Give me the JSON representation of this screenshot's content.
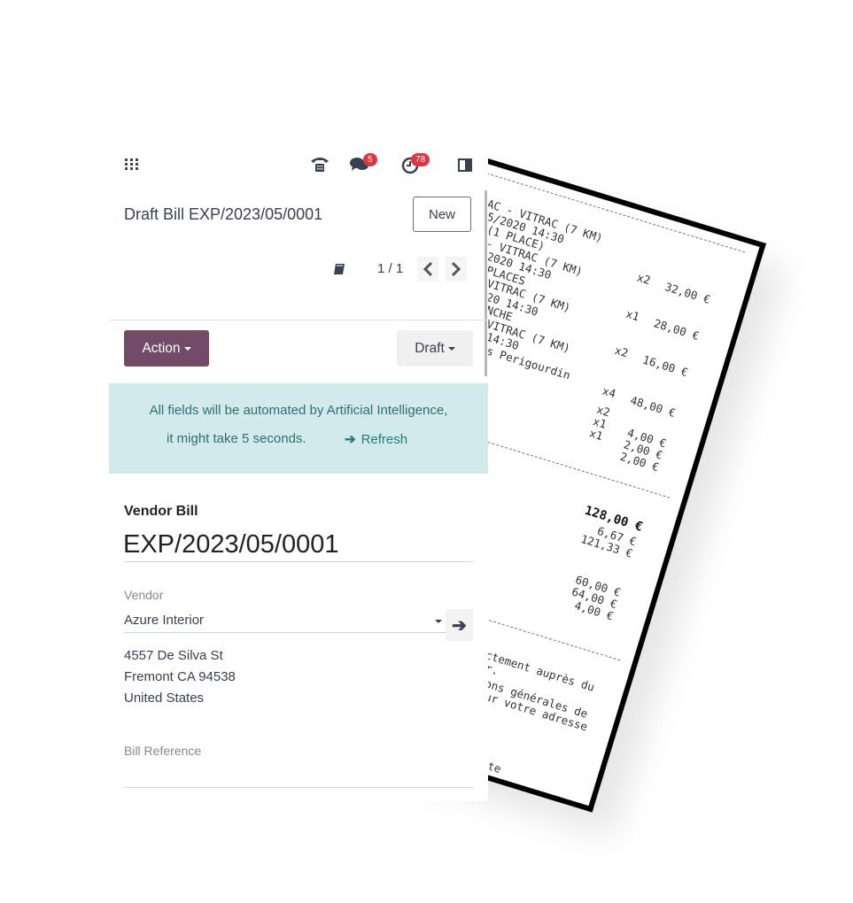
{
  "topbar": {
    "apps_icon": "grid-icon",
    "phone_icon": "phone-icon",
    "messages_icon": "chat-icon",
    "messages_count": "5",
    "activities_icon": "clock-icon",
    "activities_count": "78",
    "panel_icon": "split-panel-icon"
  },
  "header": {
    "title": "Draft Bill EXP/2023/05/0001",
    "new_label": "New",
    "pager": "1 / 1"
  },
  "actions": {
    "action_label": "Action",
    "status_label": "Draft"
  },
  "banner": {
    "line1": "All fields will be automated by Artificial Intelligence,",
    "line2": "it might take 5 seconds.",
    "refresh_label": "Refresh"
  },
  "form": {
    "heading": "Vendor Bill",
    "number": "EXP/2023/05/0001",
    "vendor_label": "Vendor",
    "vendor_value": "Azure Interior",
    "address": [
      "4557 De Silva St",
      "Fremont CA 94538",
      "United States"
    ],
    "bill_reference_label": "Bill Reference",
    "bill_reference_value": ""
  },
  "receipt": {
    "lines": [
      "AC - VITRAC (7 KM)",
      "5/2020 14:30",
      "(1 PLACE)",
      "- VITRAC (7 KM)",
      "2020 14:30",
      "PLACES",
      "VITRAC (7 KM)",
      "20 14:30",
      "NCHE",
      "VITRAC (7 KM)",
      "14:30",
      "s Perigourdin"
    ],
    "items": [
      {
        "qty": "x2",
        "price": "32,00 €"
      },
      {
        "qty": "x1",
        "price": "28,00 €"
      },
      {
        "qty": "x2",
        "price": "16,00 €"
      },
      {
        "qty": "x4",
        "price": "48,00 €"
      },
      {
        "qty": "x2",
        "price": ""
      },
      {
        "qty": "x1",
        "price": "4,00 €"
      },
      {
        "qty": "x1",
        "price": "2,00 €"
      },
      {
        "qty": "",
        "price": "2,00 €"
      }
    ],
    "total": "128,00 €",
    "tax": "6,67 €",
    "untaxed": "121,33 €",
    "payments": [
      "60,00 €",
      "64,00 €",
      "4,00 €"
    ],
    "footer": [
      "ctement auprès du",
      "r.",
      "ons générales de",
      "ur votre adresse",
      "te"
    ]
  }
}
